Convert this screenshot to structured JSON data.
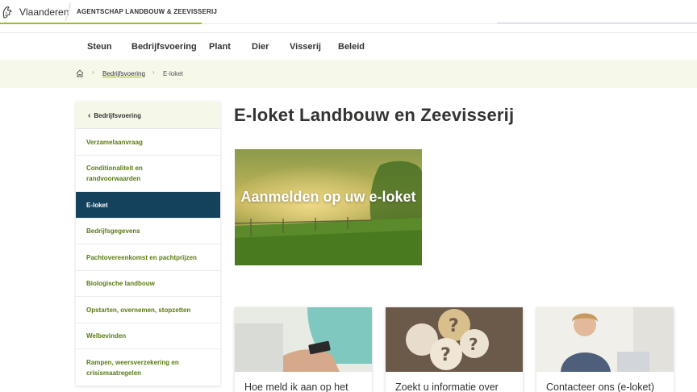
{
  "header": {
    "brand": "Vlaanderen",
    "agency": "AGENTSCHAP LANDBOUW & ZEEVISSERIJ"
  },
  "nav": {
    "items": [
      "Steun",
      "Bedrijfsvoering",
      "Plant",
      "Dier",
      "Visserij",
      "Beleid"
    ]
  },
  "breadcrumb": {
    "home_icon": "home-icon",
    "link": "Bedrijfsvoering",
    "current": "E-loket"
  },
  "sidebar": {
    "back_label": "Bedrijfsvoering",
    "items": [
      {
        "label": "Verzamelaanvraag"
      },
      {
        "label": "Conditionaliteit en randvoorwaarden"
      },
      {
        "label": "E-loket",
        "active": true
      },
      {
        "label": "Bedrijfsgegevens"
      },
      {
        "label": "Pachtovereenkomst en pachtprijzen"
      },
      {
        "label": "Biologische landbouw"
      },
      {
        "label": "Opstarten, overnemen, stopzetten"
      },
      {
        "label": "Welbevinden"
      },
      {
        "label": "Rampen, weersverzekering en crisismaatregelen"
      }
    ]
  },
  "main": {
    "title": "E-loket Landbouw en Zeevisserij",
    "hero_text": "Aanmelden op uw e-loket",
    "cards": [
      {
        "title": "Hoe meld ik aan op het"
      },
      {
        "title": "Zoekt u informatie over"
      },
      {
        "title": "Contacteer ons (e-loket)"
      }
    ]
  },
  "colors": {
    "accent_green": "#9bc11b",
    "active_blue": "#14415c",
    "link_green": "#5a7a10",
    "crumb_bg": "#f6f8ea"
  }
}
